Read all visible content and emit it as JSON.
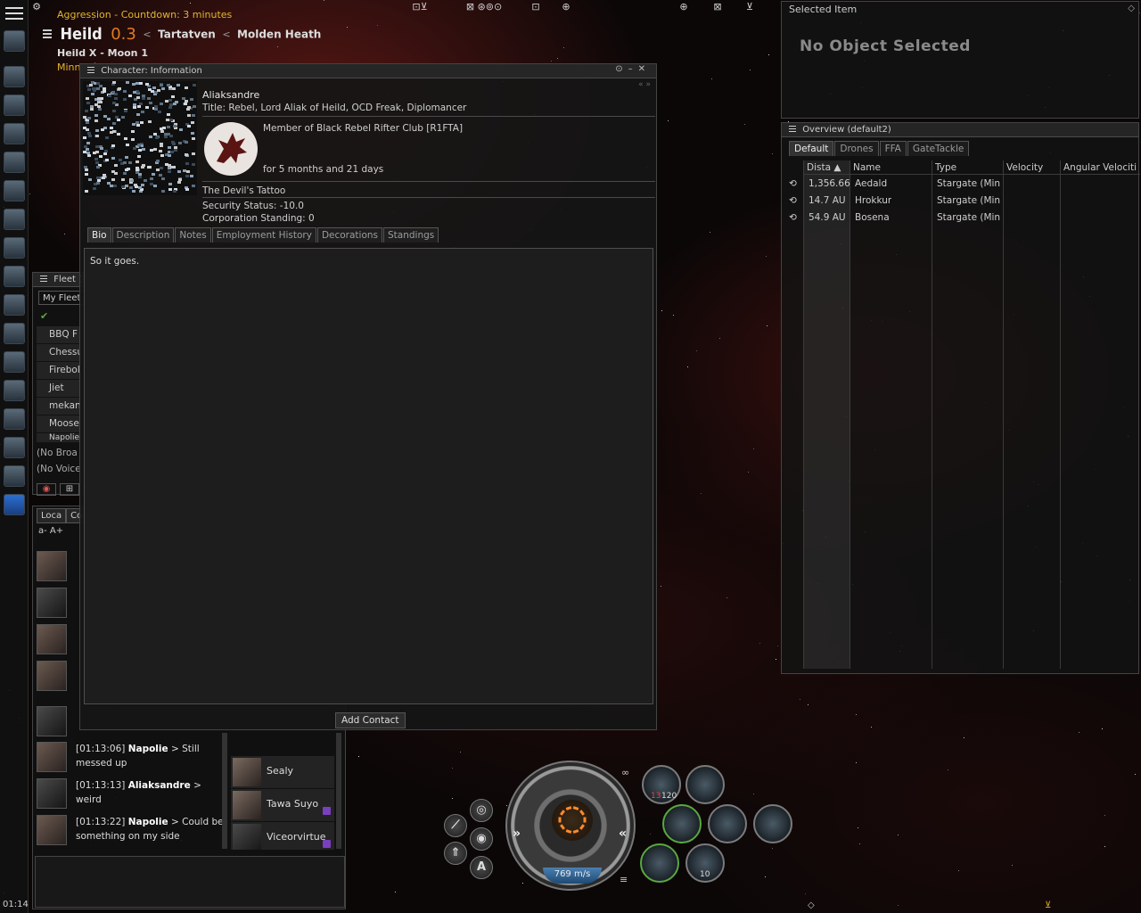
{
  "status": {
    "aggression": "Aggression - Countdown: 3 minutes",
    "system": "Heild",
    "security": "0.3",
    "constellation": "Tartatven",
    "region": "Molden Heath",
    "location": "Heild X - Moon 1",
    "partial_line": "Minn",
    "clock": "01:14"
  },
  "selected_item": {
    "title": "Selected Item",
    "empty_text": "No Object Selected"
  },
  "overview": {
    "title": "Overview (default2)",
    "tabs": [
      "Default",
      "Drones",
      "FFA",
      "GateTackle"
    ],
    "columns": [
      "Dista",
      "Name",
      "Type",
      "Velocity",
      "Angular Velociti"
    ],
    "rows": [
      {
        "distance": "1,356.66",
        "name": "Aedald",
        "type": "Stargate (Min"
      },
      {
        "distance": "14.7 AU",
        "name": "Hrokkur",
        "type": "Stargate (Min"
      },
      {
        "distance": "54.9 AU",
        "name": "Bosena",
        "type": "Stargate (Min"
      }
    ]
  },
  "character": {
    "window_title": "Character: Information",
    "name": "Aliaksandre",
    "title_line": "Title: Rebel, Lord Aliak of Heild, OCD Freak, Diplomancer",
    "corp_member": "Member of Black Rebel Rifter Club [R1FTA]",
    "corp_duration": "for 5 months and 21 days",
    "tattoo": "The Devil's Tattoo",
    "security_status": "Security Status: -10.0",
    "corp_standing": "Corporation Standing: 0",
    "tabs": [
      "Bio",
      "Description",
      "Notes",
      "Employment History",
      "Decorations",
      "Standings"
    ],
    "bio": "So it goes.",
    "add_contact": "Add Contact"
  },
  "fleet": {
    "title": "Fleet (",
    "tab": "My Fleet",
    "members": [
      "BBQ F",
      "Chessu",
      "Firebol",
      "Jiet",
      "mekani",
      "Moose",
      "Napolie"
    ],
    "broadcast": "(No Broa",
    "voice": "(No Voice"
  },
  "chat": {
    "tabs": [
      "Loca",
      "Co"
    ],
    "font_controls": "a- A+",
    "messages": [
      {
        "time": "[01:13:06]",
        "sender": "Napolie",
        "text": "Still messed up"
      },
      {
        "time": "[01:13:13]",
        "sender": "Aliaksandre",
        "text": "weird"
      },
      {
        "time": "[01:13:22]",
        "sender": "Napolie",
        "text": "Could be something on my side"
      }
    ],
    "members": [
      "Sealy",
      "Tawa Suyo",
      "Viceorvirtue"
    ]
  },
  "hud": {
    "speed": "769 m/s",
    "module_charges": [
      "13",
      "120",
      "10"
    ],
    "autopilot_label": "A"
  },
  "colors": {
    "aggression_text": "#e3b62c",
    "security_low": "#e07b22",
    "module_active_ring": "#5aa840"
  }
}
